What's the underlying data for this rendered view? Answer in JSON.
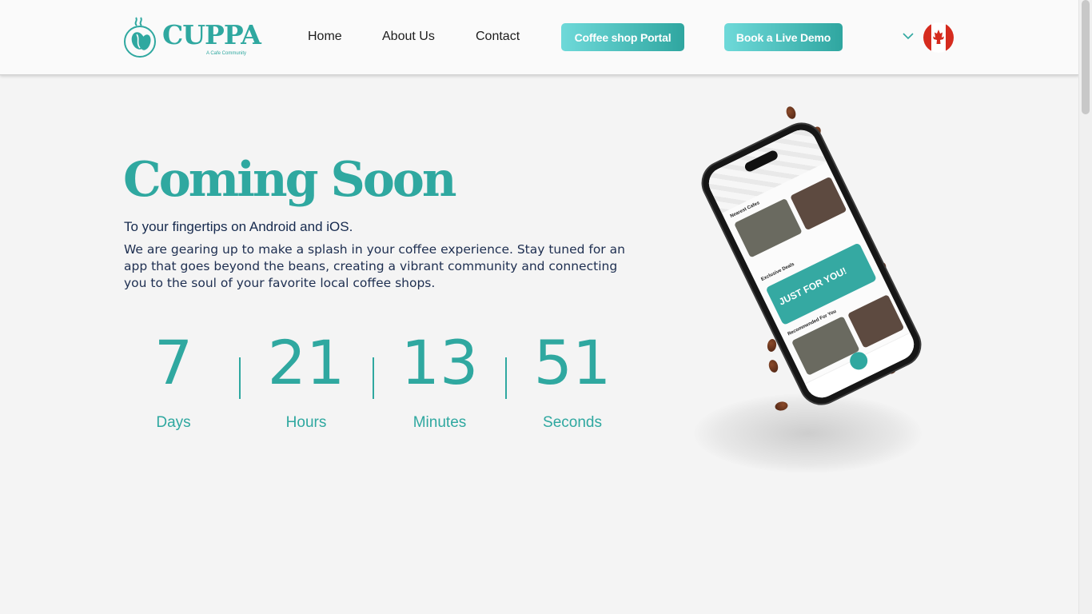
{
  "header": {
    "logo_text": "CUPPA",
    "logo_tagline": "A Cafe Community",
    "nav": [
      "Home",
      "About Us",
      "Contact"
    ],
    "portal_button": "Coffee shop Portal",
    "demo_button": "Book a Live Demo",
    "country_flag": "canada-flag"
  },
  "hero": {
    "title": "Coming Soon",
    "subtitle": "To your fingertips on Android and iOS.",
    "description": "We are gearing up to make a splash in your coffee experience. Stay tuned for an app that goes beyond the beans, creating a vibrant community and connecting you to the soul of your favorite local coffee shops."
  },
  "countdown": [
    {
      "value": "7",
      "label": "Days"
    },
    {
      "value": "21",
      "label": "Hours"
    },
    {
      "value": "13",
      "label": "Minutes"
    },
    {
      "value": "51",
      "label": "Seconds"
    }
  ],
  "phone_app": {
    "section1": "Nearest Cafes",
    "section2": "Exclusive Deals",
    "promo": "JUST FOR YOU!",
    "section3": "Recommended For You"
  },
  "colors": {
    "accent": "#2fa8a0",
    "button_gradient_start": "#6ed9d9",
    "text_dark": "#1d2b4a",
    "background": "#f4f4f4"
  }
}
